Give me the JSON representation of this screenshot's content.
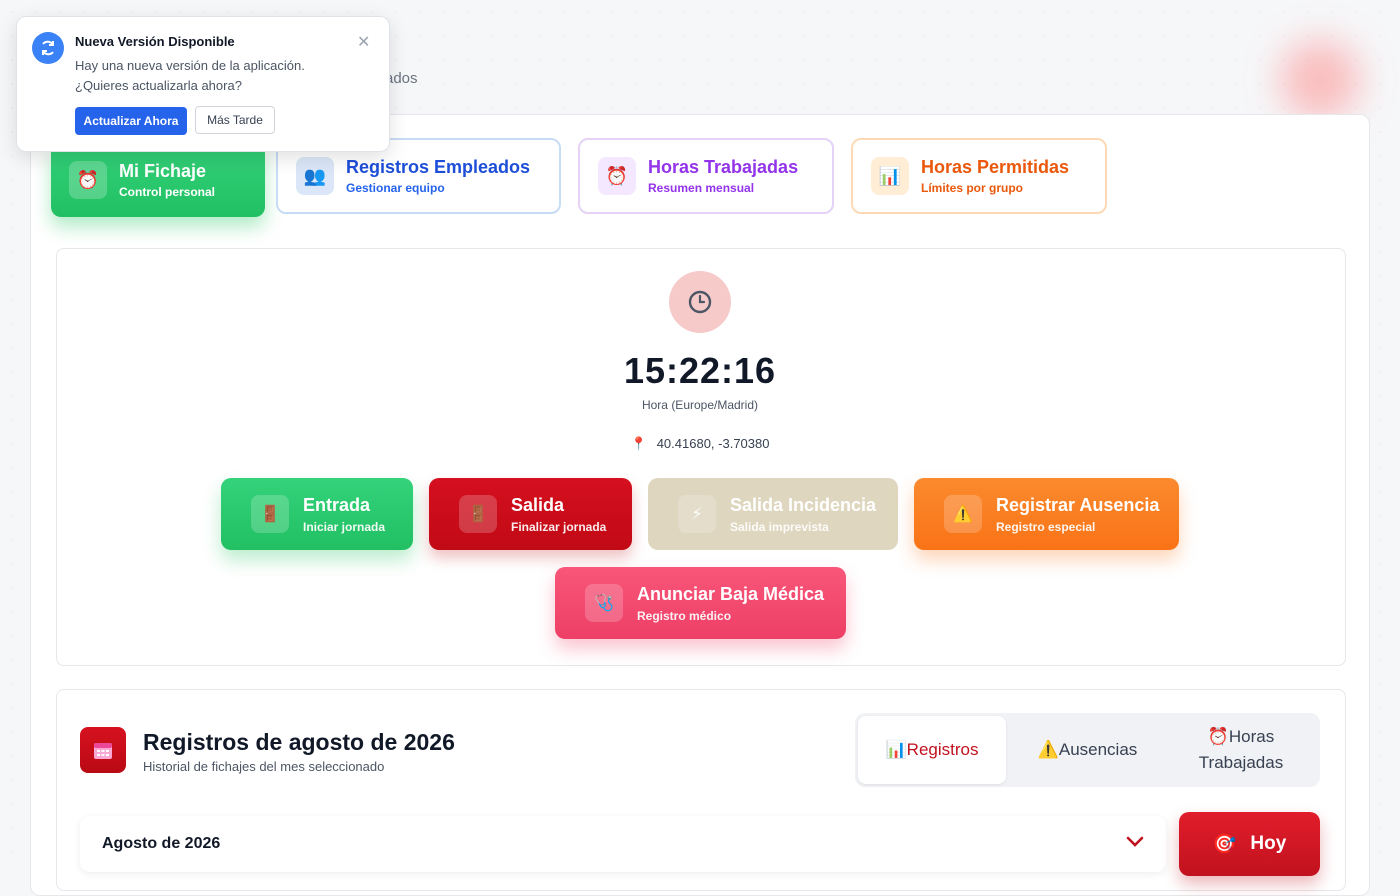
{
  "header": {
    "subtitle_fragment": "ados"
  },
  "tabs": [
    {
      "title": "Mi Fichaje",
      "sub": "Control personal",
      "icon": "alarm-clock-icon"
    },
    {
      "title": "Registros Empleados",
      "sub": "Gestionar equipo",
      "icon": "users-icon"
    },
    {
      "title": "Horas Trabajadas",
      "sub": "Resumen mensual",
      "icon": "alarm-clock-icon"
    },
    {
      "title": "Horas Permitidas",
      "sub": "Límites por grupo",
      "icon": "bar-chart-icon"
    }
  ],
  "clock": {
    "time": "15:22:16",
    "timezone": "Hora (Europe/Madrid)",
    "coords": "40.41680, -3.70380"
  },
  "actions": {
    "entrada": {
      "title": "Entrada",
      "sub": "Iniciar jornada"
    },
    "salida": {
      "title": "Salida",
      "sub": "Finalizar jornada"
    },
    "incidencia": {
      "title": "Salida Incidencia",
      "sub": "Salida imprevista"
    },
    "ausencia": {
      "title": "Registrar Ausencia",
      "sub": "Registro especial"
    },
    "baja": {
      "title": "Anunciar Baja Médica",
      "sub": "Registro médico"
    }
  },
  "registros": {
    "title": "Registros de agosto de 2026",
    "sub": "Historial de fichajes del mes seleccionado",
    "segments": {
      "registros": "Registros",
      "ausencias": "Ausencias",
      "horas_line1": "Horas",
      "horas_line2": "Trabajadas"
    },
    "month": "Agosto de 2026",
    "hoy": "Hoy"
  },
  "notification": {
    "title": "Nueva Versión Disponible",
    "message": "Hay una nueva versión de la aplicación. ¿Quieres actualizarla ahora?",
    "primary": "Actualizar Ahora",
    "secondary": "Más Tarde"
  },
  "colors": {
    "green": "#22c063",
    "red": "#c1121f",
    "orange": "#f97316",
    "pink": "#ee3f66",
    "blue": "#2563eb",
    "purple": "#9333ea"
  }
}
